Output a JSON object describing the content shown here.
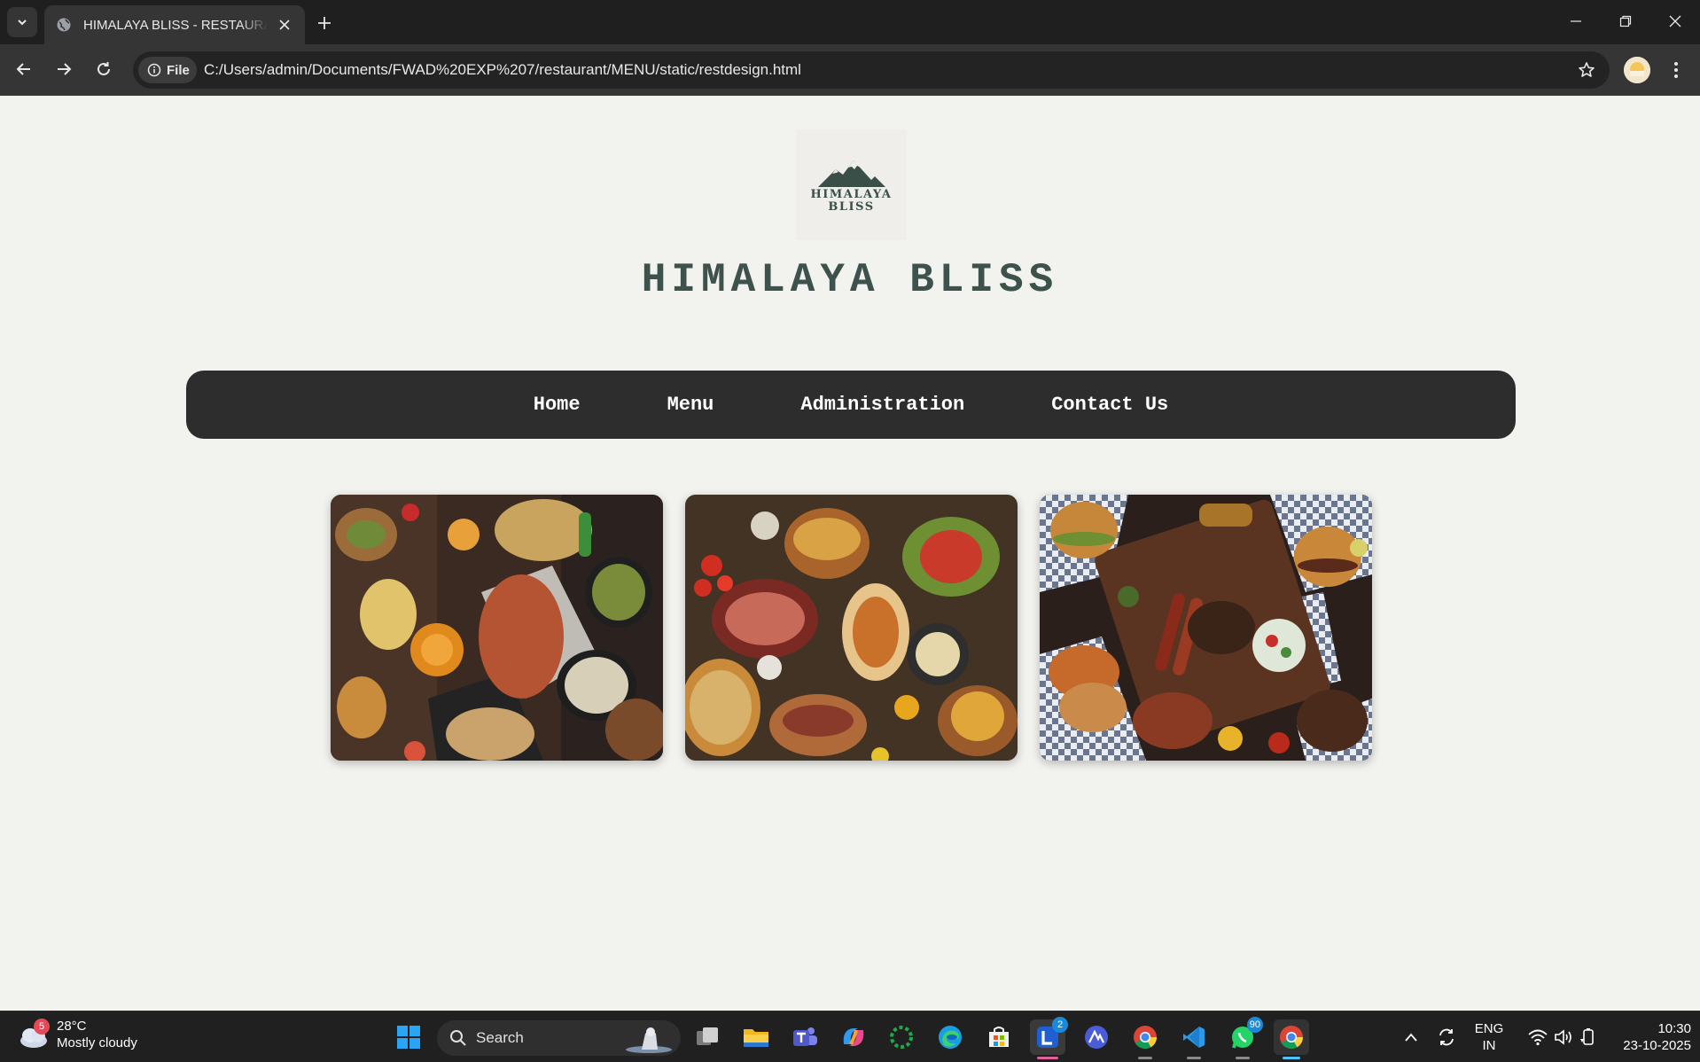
{
  "browser": {
    "tab_title": "HIMALAYA BLISS - RESTAURANT",
    "site_chip_label": "File",
    "url": "C:/Users/admin/Documents/FWAD%20EXP%207/restaurant/MENU/static/restdesign.html"
  },
  "page": {
    "logo_line1": "HIMALAYA",
    "logo_line2": "BLISS",
    "title": "HIMALAYA BLISS",
    "nav": [
      {
        "label": "Home"
      },
      {
        "label": "Menu"
      },
      {
        "label": "Administration"
      },
      {
        "label": "Contact Us"
      }
    ]
  },
  "taskbar": {
    "weather_badge": "5",
    "weather_temp": "28°C",
    "weather_desc": "Mostly cloudy",
    "search_label": "Search",
    "lens_badge": "2",
    "whatsapp_badge": "90",
    "lang_line1": "ENG",
    "lang_line2": "IN",
    "time": "10:30",
    "date": "23-10-2025"
  },
  "colors": {
    "title": "#3d524c",
    "navbar": "#2d2d2d",
    "page_bg": "#f2f2ef"
  }
}
